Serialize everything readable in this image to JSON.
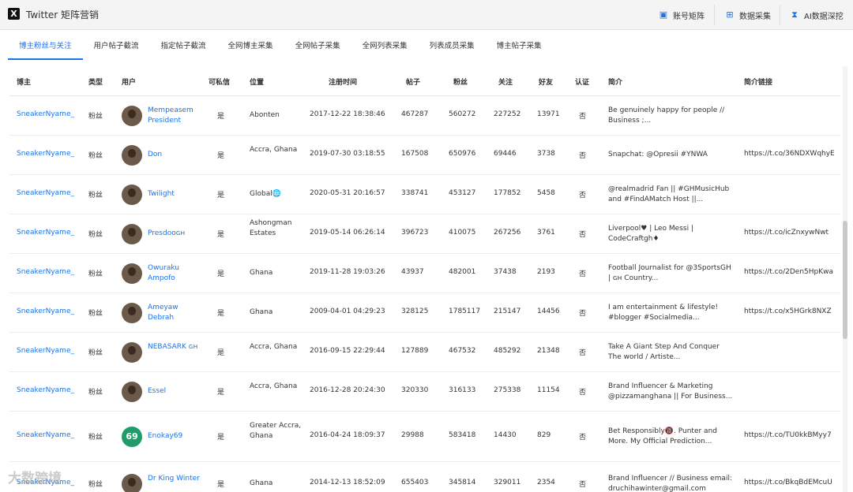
{
  "app": {
    "title": "Twitter 矩阵营销",
    "logo": "X"
  },
  "header_buttons": [
    {
      "label": "账号矩阵",
      "icon": "account-matrix-icon"
    },
    {
      "label": "数据采集",
      "icon": "grid-icon"
    },
    {
      "label": "AI数据深挖",
      "icon": "hourglass-icon"
    }
  ],
  "tabs": [
    "博主粉丝与关注",
    "用户帖子截流",
    "指定帖子截流",
    "全网博主采集",
    "全网帖子采集",
    "全网列表采集",
    "列表成员采集",
    "博主帖子采集"
  ],
  "active_tab": 0,
  "columns": [
    "博主",
    "类型",
    "用户",
    "可私信",
    "位置",
    "注册时间",
    "帖子",
    "粉丝",
    "关注",
    "好友",
    "认证",
    "简介",
    "简介链接"
  ],
  "rows": [
    {
      "blogger": "SneakerNyame_",
      "type": "粉丝",
      "user": "Mempeasem President",
      "dm": "是",
      "location": "Abonten",
      "registered": "2017-12-22 18:38:46",
      "posts": "467287",
      "followers": "560272",
      "following": "227252",
      "friends": "13971",
      "verified": "否",
      "bio": "Be genuinely happy for people // Business ;...",
      "link": ""
    },
    {
      "blogger": "SneakerNyame_",
      "type": "粉丝",
      "user": "Don",
      "dm": "是",
      "location": "Accra, Ghana",
      "registered": "2019-07-30 03:18:55",
      "posts": "167508",
      "followers": "650976",
      "following": "69446",
      "friends": "3738",
      "verified": "否",
      "bio": "Snapchat: @Opresii #YNWA",
      "link": "https://t.co/36NDXWqhyE"
    },
    {
      "blogger": "SneakerNyame_",
      "type": "粉丝",
      "user": "Twilight",
      "dm": "是",
      "location": "Global🌐",
      "registered": "2020-05-31 20:16:57",
      "posts": "338741",
      "followers": "453127",
      "following": "177852",
      "friends": "5458",
      "verified": "否",
      "bio": "@realmadrid Fan || #GHMusicHub and #FindAMatch Host ||...",
      "link": ""
    },
    {
      "blogger": "SneakerNyame_",
      "type": "粉丝",
      "user": "Presdooɢʜ",
      "dm": "是",
      "location": "Ashongman Estates",
      "registered": "2019-05-14 06:26:14",
      "posts": "396723",
      "followers": "410075",
      "following": "267256",
      "friends": "3761",
      "verified": "否",
      "bio": "Liverpool♥ | Leo Messi | CodeCraftgh♦",
      "link": "https://t.co/icZnxywNwt"
    },
    {
      "blogger": "SneakerNyame_",
      "type": "粉丝",
      "user": "Owuraku Ampofo",
      "dm": "是",
      "location": "Ghana",
      "registered": "2019-11-28 19:03:26",
      "posts": "43937",
      "followers": "482001",
      "following": "37438",
      "friends": "2193",
      "verified": "否",
      "bio": "Football Journalist for @3SportsGH | ɢʜ Country...",
      "link": "https://t.co/2Den5HpKwa"
    },
    {
      "blogger": "SneakerNyame_",
      "type": "粉丝",
      "user": "Ameyaw Debrah",
      "dm": "是",
      "location": "Ghana",
      "registered": "2009-04-01 04:29:23",
      "posts": "328125",
      "followers": "1785117",
      "following": "215147",
      "friends": "14456",
      "verified": "否",
      "bio": "I am entertainment & lifestyle! #blogger #Socialmedia...",
      "link": "https://t.co/x5HGrk8NXZ"
    },
    {
      "blogger": "SneakerNyame_",
      "type": "粉丝",
      "user": "NEBASARK ɢʜ",
      "dm": "是",
      "location": "Accra, Ghana",
      "registered": "2016-09-15 22:29:44",
      "posts": "127889",
      "followers": "467532",
      "following": "485292",
      "friends": "21348",
      "verified": "否",
      "bio": "Take A Giant Step And Conquer The world / Artiste...",
      "link": ""
    },
    {
      "blogger": "SneakerNyame_",
      "type": "粉丝",
      "user": "Essel",
      "dm": "是",
      "location": "Accra, Ghana",
      "registered": "2016-12-28 20:24:30",
      "posts": "320330",
      "followers": "316133",
      "following": "275338",
      "friends": "11154",
      "verified": "否",
      "bio": "Brand Influencer & Marketing @pizzamanghana || For Business...",
      "link": ""
    },
    {
      "blogger": "SneakerNyame_",
      "type": "粉丝",
      "user": "Enokay69",
      "dm": "是",
      "location": "Greater Accra, Ghana",
      "registered": "2016-04-24 18:09:37",
      "posts": "29988",
      "followers": "583418",
      "following": "14430",
      "friends": "829",
      "verified": "否",
      "bio": "Bet Responsibly🔞. Punter and More. My Official Prediction...",
      "link": "https://t.co/TU0kkBMyy7"
    },
    {
      "blogger": "SneakerNyame_",
      "type": "粉丝",
      "user": "Dr King Winter",
      "dm": "是",
      "location": "Ghana",
      "registered": "2014-12-13 18:52:09",
      "posts": "655403",
      "followers": "345814",
      "following": "329011",
      "friends": "2354",
      "verified": "否",
      "bio": "Brand Influencer // Business email: druchihawinter@gmail.com",
      "link": "https://t.co/BkqBdEMcuU"
    }
  ],
  "watermark": "大数跨境"
}
